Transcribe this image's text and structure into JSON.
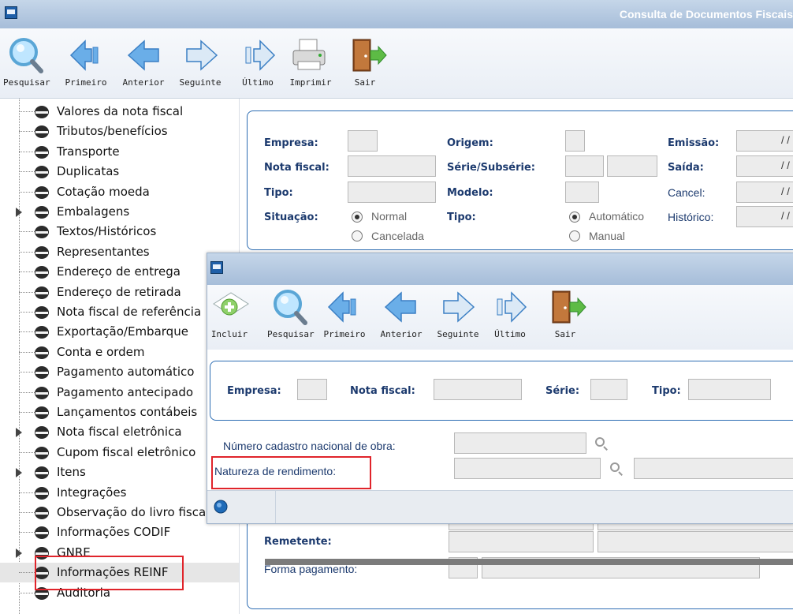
{
  "main_window": {
    "title": "Consulta de Documentos Fiscais",
    "toolbar": [
      {
        "id": "pesquisar",
        "label": "Pesquisar",
        "icon": "magnifier-icon"
      },
      {
        "id": "primeiro",
        "label": "Primeiro",
        "icon": "first-arrow-icon"
      },
      {
        "id": "anterior",
        "label": "Anterior",
        "icon": "previous-arrow-icon"
      },
      {
        "id": "seguinte",
        "label": "Seguinte",
        "icon": "next-arrow-icon"
      },
      {
        "id": "ultimo",
        "label": "Último",
        "icon": "last-arrow-icon"
      },
      {
        "id": "imprimir",
        "label": "Imprimir",
        "icon": "printer-icon"
      },
      {
        "id": "sair",
        "label": "Sair",
        "icon": "exit-door-icon"
      }
    ]
  },
  "tree": {
    "items": [
      {
        "label": "Valores da nota fiscal",
        "expandable": false
      },
      {
        "label": "Tributos/benefícios",
        "expandable": false
      },
      {
        "label": "Transporte",
        "expandable": false
      },
      {
        "label": "Duplicatas",
        "expandable": false
      },
      {
        "label": "Cotação moeda",
        "expandable": false
      },
      {
        "label": "Embalagens",
        "expandable": true
      },
      {
        "label": "Textos/Históricos",
        "expandable": false
      },
      {
        "label": "Representantes",
        "expandable": false
      },
      {
        "label": "Endereço de entrega",
        "expandable": false
      },
      {
        "label": "Endereço de retirada",
        "expandable": false
      },
      {
        "label": "Nota fiscal de referência",
        "expandable": false
      },
      {
        "label": "Exportação/Embarque",
        "expandable": false
      },
      {
        "label": "Conta e ordem",
        "expandable": false
      },
      {
        "label": "Pagamento automático",
        "expandable": false
      },
      {
        "label": "Pagamento antecipado",
        "expandable": false
      },
      {
        "label": "Lançamentos contábeis",
        "expandable": false
      },
      {
        "label": "Nota fiscal eletrônica",
        "expandable": true
      },
      {
        "label": "Cupom fiscal eletrônico",
        "expandable": false
      },
      {
        "label": "Itens",
        "expandable": true
      },
      {
        "label": "Integrações",
        "expandable": false
      },
      {
        "label": "Observação do livro fiscal",
        "expandable": false
      },
      {
        "label": "Informações CODIF",
        "expandable": false
      },
      {
        "label": "GNRE",
        "expandable": true
      },
      {
        "label": "Informações REINF",
        "expandable": false,
        "selected": true
      },
      {
        "label": "Auditoria",
        "expandable": false
      }
    ]
  },
  "header_form": {
    "empresa_label": "Empresa:",
    "nota_fiscal_label": "Nota fiscal:",
    "tipo_label": "Tipo:",
    "situacao_label": "Situação:",
    "situacao_options": [
      "Normal",
      "Cancelada"
    ],
    "situacao_selected": "Normal",
    "origem_label": "Origem:",
    "serie_label": "Série/Subsérie:",
    "modelo_label": "Modelo:",
    "tipo2_label": "Tipo:",
    "tipo2_options": [
      "Automático",
      "Manual"
    ],
    "tipo2_selected": "Automático",
    "emissao_label": "Emissão:",
    "saida_label": "Saída:",
    "cancel_label": "Cancel:",
    "historico_label": "Histórico:",
    "date_placeholder": "/ /"
  },
  "lower_form": {
    "remetente_label": "Remetente:",
    "forma_pagamento_label": "Forma pagamento:"
  },
  "dialog": {
    "toolbar": [
      {
        "id": "incluir",
        "label": "Incluir",
        "icon": "add-document-icon"
      },
      {
        "id": "pesquisar",
        "label": "Pesquisar",
        "icon": "magnifier-icon"
      },
      {
        "id": "primeiro",
        "label": "Primeiro",
        "icon": "first-arrow-icon"
      },
      {
        "id": "anterior",
        "label": "Anterior",
        "icon": "previous-arrow-icon"
      },
      {
        "id": "seguinte",
        "label": "Seguinte",
        "icon": "next-arrow-icon"
      },
      {
        "id": "ultimo",
        "label": "Último",
        "icon": "last-arrow-icon"
      },
      {
        "id": "sair",
        "label": "Sair",
        "icon": "exit-door-icon"
      }
    ],
    "form": {
      "empresa_label": "Empresa:",
      "nota_fiscal_label": "Nota fiscal:",
      "serie_label": "Série:",
      "tipo_label": "Tipo:"
    },
    "cno_label": "Número cadastro nacional de obra:",
    "natureza_label": "Natureza de rendimento:"
  },
  "colors": {
    "accent": "#2d6db3",
    "label": "#1c3a6e",
    "highlight": "#e0242b",
    "titlebar": "#a6bdd9"
  }
}
